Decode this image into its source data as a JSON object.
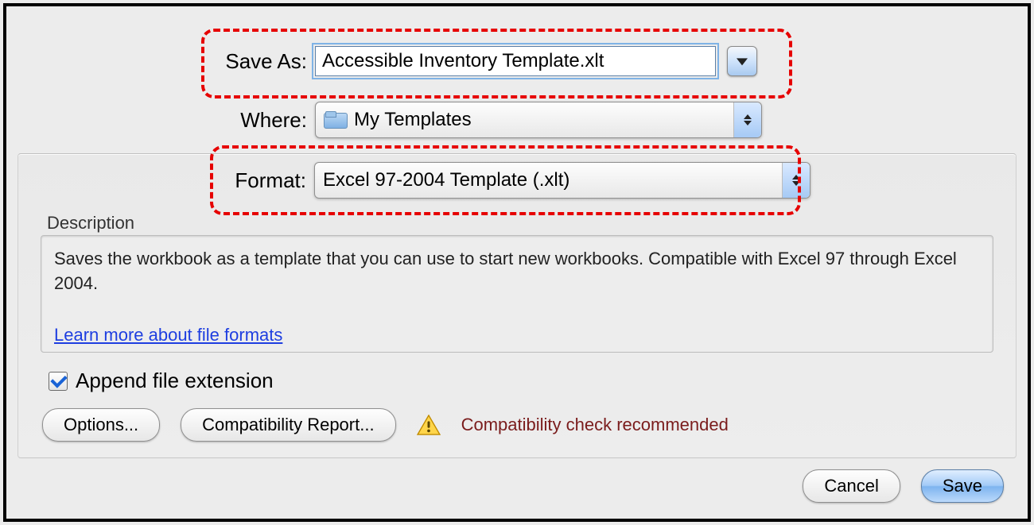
{
  "labels": {
    "saveAs": "Save As:",
    "where": "Where:",
    "format": "Format:",
    "description": "Description"
  },
  "saveAsValue": "Accessible Inventory Template.xlt",
  "whereValue": "My Templates",
  "formatValue": "Excel 97-2004 Template (.xlt)",
  "descriptionText": "Saves the workbook as a template that you can use to start new workbooks. Compatible with Excel 97 through Excel 2004.",
  "linkText": "Learn more about file formats",
  "checkbox": {
    "appendExt": "Append file extension",
    "checked": true
  },
  "buttons": {
    "options": "Options...",
    "compat": "Compatibility Report...",
    "cancel": "Cancel",
    "save": "Save"
  },
  "compatWarning": "Compatibility check recommended"
}
